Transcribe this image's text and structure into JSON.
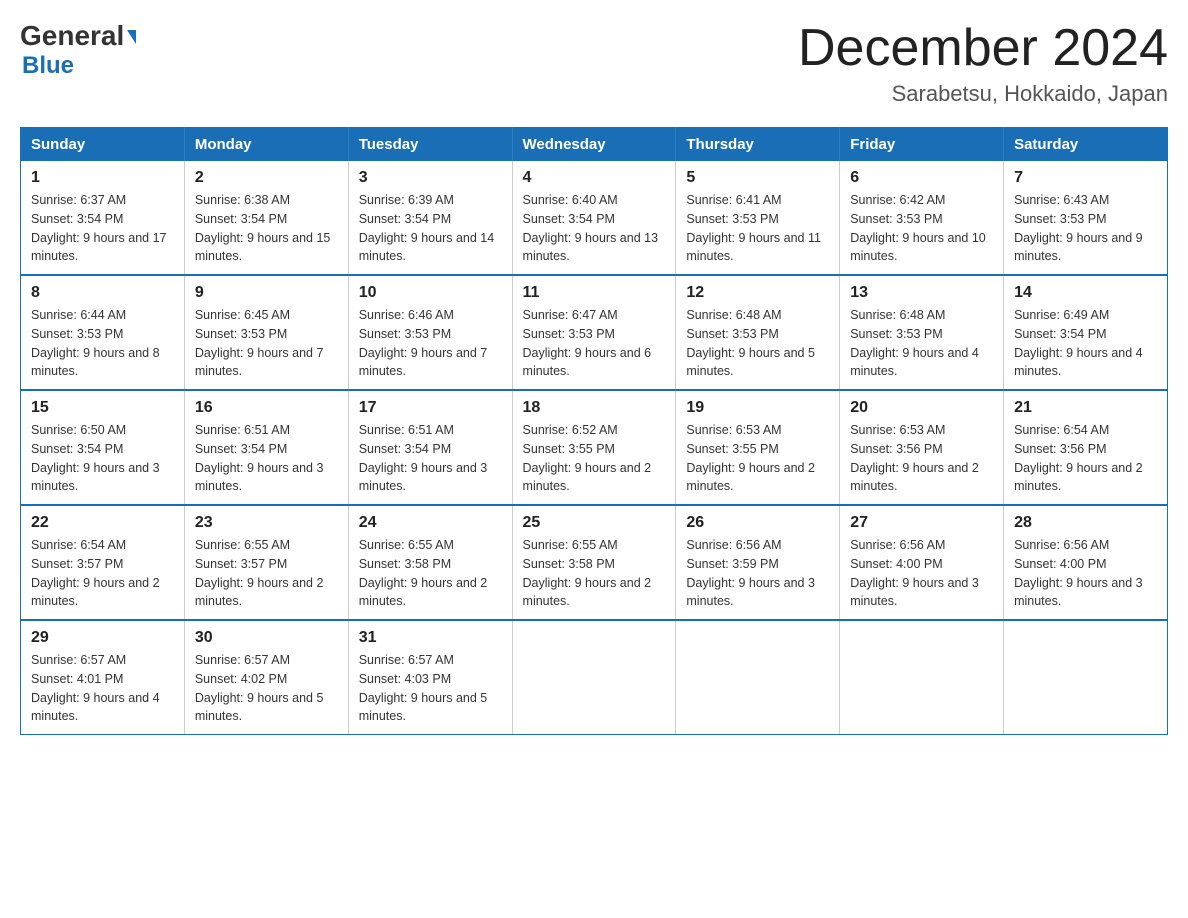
{
  "logo": {
    "general": "General",
    "blue": "Blue",
    "arrow": "▶"
  },
  "title": "December 2024",
  "location": "Sarabetsu, Hokkaido, Japan",
  "days_of_week": [
    "Sunday",
    "Monday",
    "Tuesday",
    "Wednesday",
    "Thursday",
    "Friday",
    "Saturday"
  ],
  "weeks": [
    [
      {
        "day": "1",
        "sunrise": "6:37 AM",
        "sunset": "3:54 PM",
        "daylight": "9 hours and 17 minutes."
      },
      {
        "day": "2",
        "sunrise": "6:38 AM",
        "sunset": "3:54 PM",
        "daylight": "9 hours and 15 minutes."
      },
      {
        "day": "3",
        "sunrise": "6:39 AM",
        "sunset": "3:54 PM",
        "daylight": "9 hours and 14 minutes."
      },
      {
        "day": "4",
        "sunrise": "6:40 AM",
        "sunset": "3:54 PM",
        "daylight": "9 hours and 13 minutes."
      },
      {
        "day": "5",
        "sunrise": "6:41 AM",
        "sunset": "3:53 PM",
        "daylight": "9 hours and 11 minutes."
      },
      {
        "day": "6",
        "sunrise": "6:42 AM",
        "sunset": "3:53 PM",
        "daylight": "9 hours and 10 minutes."
      },
      {
        "day": "7",
        "sunrise": "6:43 AM",
        "sunset": "3:53 PM",
        "daylight": "9 hours and 9 minutes."
      }
    ],
    [
      {
        "day": "8",
        "sunrise": "6:44 AM",
        "sunset": "3:53 PM",
        "daylight": "9 hours and 8 minutes."
      },
      {
        "day": "9",
        "sunrise": "6:45 AM",
        "sunset": "3:53 PM",
        "daylight": "9 hours and 7 minutes."
      },
      {
        "day": "10",
        "sunrise": "6:46 AM",
        "sunset": "3:53 PM",
        "daylight": "9 hours and 7 minutes."
      },
      {
        "day": "11",
        "sunrise": "6:47 AM",
        "sunset": "3:53 PM",
        "daylight": "9 hours and 6 minutes."
      },
      {
        "day": "12",
        "sunrise": "6:48 AM",
        "sunset": "3:53 PM",
        "daylight": "9 hours and 5 minutes."
      },
      {
        "day": "13",
        "sunrise": "6:48 AM",
        "sunset": "3:53 PM",
        "daylight": "9 hours and 4 minutes."
      },
      {
        "day": "14",
        "sunrise": "6:49 AM",
        "sunset": "3:54 PM",
        "daylight": "9 hours and 4 minutes."
      }
    ],
    [
      {
        "day": "15",
        "sunrise": "6:50 AM",
        "sunset": "3:54 PM",
        "daylight": "9 hours and 3 minutes."
      },
      {
        "day": "16",
        "sunrise": "6:51 AM",
        "sunset": "3:54 PM",
        "daylight": "9 hours and 3 minutes."
      },
      {
        "day": "17",
        "sunrise": "6:51 AM",
        "sunset": "3:54 PM",
        "daylight": "9 hours and 3 minutes."
      },
      {
        "day": "18",
        "sunrise": "6:52 AM",
        "sunset": "3:55 PM",
        "daylight": "9 hours and 2 minutes."
      },
      {
        "day": "19",
        "sunrise": "6:53 AM",
        "sunset": "3:55 PM",
        "daylight": "9 hours and 2 minutes."
      },
      {
        "day": "20",
        "sunrise": "6:53 AM",
        "sunset": "3:56 PM",
        "daylight": "9 hours and 2 minutes."
      },
      {
        "day": "21",
        "sunrise": "6:54 AM",
        "sunset": "3:56 PM",
        "daylight": "9 hours and 2 minutes."
      }
    ],
    [
      {
        "day": "22",
        "sunrise": "6:54 AM",
        "sunset": "3:57 PM",
        "daylight": "9 hours and 2 minutes."
      },
      {
        "day": "23",
        "sunrise": "6:55 AM",
        "sunset": "3:57 PM",
        "daylight": "9 hours and 2 minutes."
      },
      {
        "day": "24",
        "sunrise": "6:55 AM",
        "sunset": "3:58 PM",
        "daylight": "9 hours and 2 minutes."
      },
      {
        "day": "25",
        "sunrise": "6:55 AM",
        "sunset": "3:58 PM",
        "daylight": "9 hours and 2 minutes."
      },
      {
        "day": "26",
        "sunrise": "6:56 AM",
        "sunset": "3:59 PM",
        "daylight": "9 hours and 3 minutes."
      },
      {
        "day": "27",
        "sunrise": "6:56 AM",
        "sunset": "4:00 PM",
        "daylight": "9 hours and 3 minutes."
      },
      {
        "day": "28",
        "sunrise": "6:56 AM",
        "sunset": "4:00 PM",
        "daylight": "9 hours and 3 minutes."
      }
    ],
    [
      {
        "day": "29",
        "sunrise": "6:57 AM",
        "sunset": "4:01 PM",
        "daylight": "9 hours and 4 minutes."
      },
      {
        "day": "30",
        "sunrise": "6:57 AM",
        "sunset": "4:02 PM",
        "daylight": "9 hours and 5 minutes."
      },
      {
        "day": "31",
        "sunrise": "6:57 AM",
        "sunset": "4:03 PM",
        "daylight": "9 hours and 5 minutes."
      },
      null,
      null,
      null,
      null
    ]
  ]
}
